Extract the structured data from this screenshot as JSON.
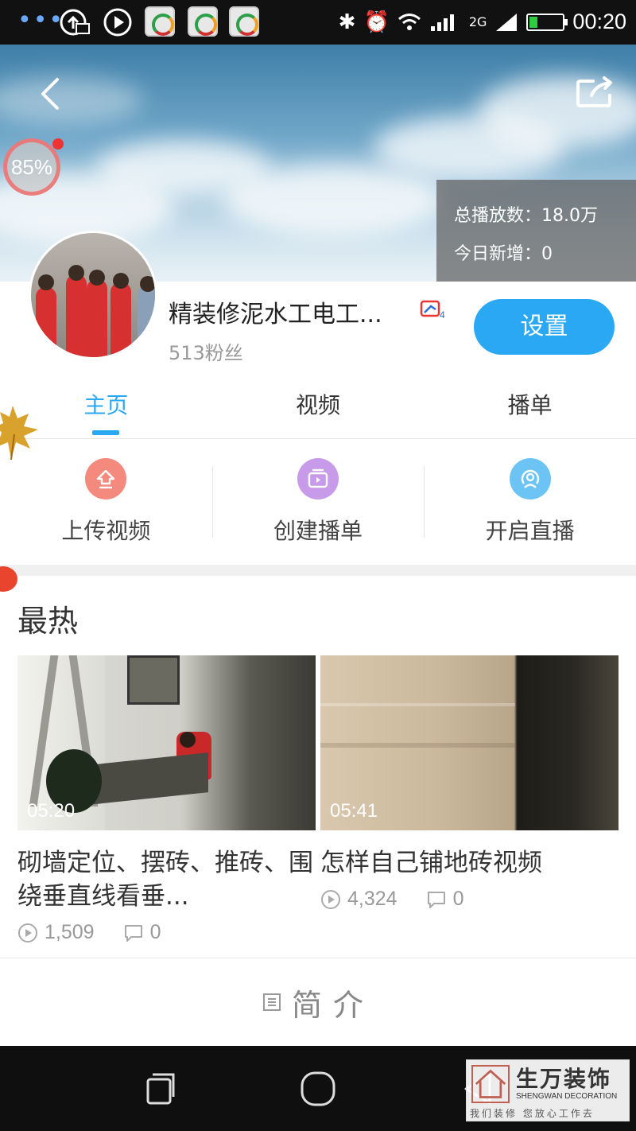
{
  "status_bar": {
    "time": "00:20",
    "network_label": "2G",
    "icons": [
      "more-dots-icon",
      "notification-icon",
      "play-icon",
      "app-icon",
      "app-icon",
      "app-icon",
      "bluetooth-icon",
      "alarm-icon",
      "wifi-icon",
      "signal-icon",
      "battery-icon"
    ]
  },
  "header": {
    "progress_percent": "85%",
    "stats": {
      "total_plays": "总播放数：18.0万",
      "today_new": "今日新增：0"
    }
  },
  "profile": {
    "channel_name": "精装修泥水工电工...",
    "fans": "513粉丝",
    "settings_label": "设置"
  },
  "tabs": [
    {
      "label": "主页",
      "active": true
    },
    {
      "label": "视频",
      "active": false
    },
    {
      "label": "播单",
      "active": false
    }
  ],
  "actions": [
    {
      "label": "上传视频",
      "icon": "upload-icon",
      "color": "#f48a7d"
    },
    {
      "label": "创建播单",
      "icon": "playlist-icon",
      "color": "#c79be9"
    },
    {
      "label": "开启直播",
      "icon": "live-icon",
      "color": "#6cc4f4"
    }
  ],
  "hot": {
    "title": "最热",
    "videos": [
      {
        "duration": "05:20",
        "title": "砌墙定位、摆砖、推砖、围绕垂直线看垂...",
        "plays": "1,509",
        "comments": "0"
      },
      {
        "duration": "05:41",
        "title": "怎样自己铺地砖视频",
        "plays": "4,324",
        "comments": "0"
      }
    ]
  },
  "intro": {
    "label": "简介"
  },
  "watermark": {
    "name": "生万装饰",
    "english": "SHENGWAN DECORATION",
    "slogan": "我们装修 您放心工作去"
  },
  "colors": {
    "accent": "#2ba8f3",
    "upload": "#f48a7d",
    "playlist": "#c79be9",
    "live": "#6cc4f4"
  }
}
